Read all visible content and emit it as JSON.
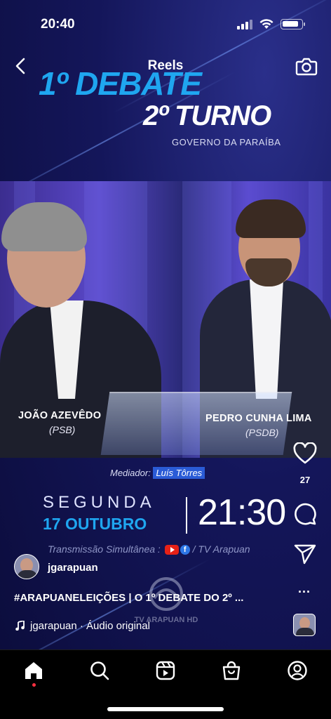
{
  "status_bar": {
    "time": "20:40"
  },
  "header": {
    "title": "Reels"
  },
  "banner": {
    "line1": "1º DEBATE",
    "line2": "2º TURNO",
    "subtitle": "GOVERNO DA PARAÍBA"
  },
  "candidates": [
    {
      "name": "JOÃO AZEVÊDO",
      "party": "(PSB)"
    },
    {
      "name": "PEDRO CUNHA LIMA",
      "party": "(PSDB)"
    }
  ],
  "schedule": {
    "mediator_label": "Mediador:",
    "mediator_name": "Luís Tôrres",
    "weekday": "SEGUNDA",
    "date": "17 OUTUBRO",
    "time": "21:30",
    "broadcast_prefix": "Transmissão Simultânea :",
    "broadcast_suffix": "/ TV Arapuan",
    "watermark": "TV ARAPUAN HD"
  },
  "actions": {
    "like_icon": "heart-icon",
    "like_count": "27",
    "comment_icon": "comment-icon",
    "share_icon": "send-icon",
    "more": "..."
  },
  "post": {
    "author": "jgarapuan",
    "caption": "#ARAPUANELEIÇÕES | O 1º DEBATE DO 2º ...",
    "audio": "jgarapuan · Áudio original"
  },
  "nav": [
    "home-icon",
    "search-icon",
    "reels-icon",
    "shop-icon",
    "profile-icon"
  ],
  "colors": {
    "accent_blue": "#1fa6f0",
    "background": "#14165a",
    "notification": "#ff3040"
  }
}
